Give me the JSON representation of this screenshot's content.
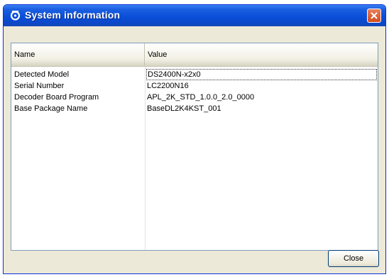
{
  "window": {
    "title": "System information",
    "icon": "app-icon",
    "accent": "#0a4fd9"
  },
  "list": {
    "columns": [
      "Name",
      "Value"
    ],
    "rows": [
      {
        "name": "Detected Model",
        "value": "DS2400N-x2x0",
        "selected": true
      },
      {
        "name": "Serial Number",
        "value": "LC2200N16",
        "selected": false
      },
      {
        "name": "Decoder Board Program",
        "value": "APL_2K_STD_1.0.0_2.0_0000",
        "selected": false
      },
      {
        "name": "Base Package Name",
        "value": "BaseDL2K4KST_001",
        "selected": false
      }
    ]
  },
  "buttons": {
    "close_label": "Close"
  }
}
